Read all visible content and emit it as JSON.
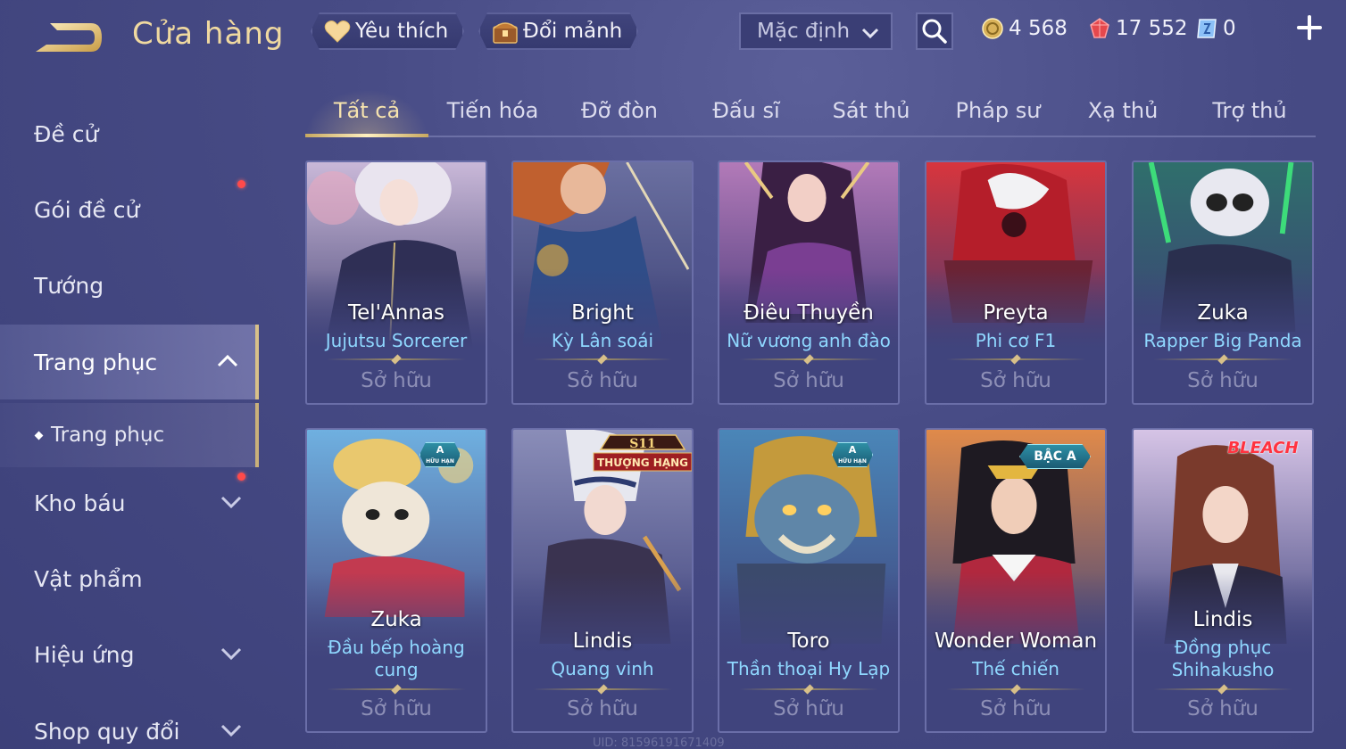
{
  "header": {
    "title": "Cửa hàng",
    "favorites_label": "Yêu thích",
    "exchange_label": "Đổi mảnh",
    "sort": {
      "selected": "Mặc định"
    },
    "currencies": [
      {
        "name": "gold-coin",
        "value": "4 568",
        "color": "#e8c66a"
      },
      {
        "name": "ruby",
        "value": "17 552",
        "color": "#e5484d"
      },
      {
        "name": "voucher",
        "value": "0",
        "color": "#6aa9f0"
      }
    ]
  },
  "sidebar": {
    "items": [
      {
        "label": "Đề cử"
      },
      {
        "label": "Gói đề cử"
      },
      {
        "label": "Tướng"
      },
      {
        "label": "Trang phục"
      },
      {
        "label": "Trang phục"
      },
      {
        "label": "Kho báu"
      },
      {
        "label": "Vật phẩm"
      },
      {
        "label": "Hiệu ứng"
      },
      {
        "label": "Shop quy đổi"
      }
    ]
  },
  "tabs": [
    {
      "label": "Tất cả"
    },
    {
      "label": "Tiến hóa"
    },
    {
      "label": "Đỡ đòn"
    },
    {
      "label": "Đấu sĩ"
    },
    {
      "label": "Sát thủ"
    },
    {
      "label": "Pháp sư"
    },
    {
      "label": "Xạ thủ"
    },
    {
      "label": "Trợ thủ"
    }
  ],
  "cards": [
    {
      "hero": "Tel'Annas",
      "skin": "Jujutsu Sorcerer",
      "status": "Sở hữu"
    },
    {
      "hero": "Bright",
      "skin": "Kỳ Lân soái",
      "status": "Sở hữu"
    },
    {
      "hero": "Điêu Thuyền",
      "skin": "Nữ vương anh đào",
      "status": "Sở hữu"
    },
    {
      "hero": "Preyta",
      "skin": "Phi cơ F1",
      "status": "Sở hữu"
    },
    {
      "hero": "Zuka",
      "skin": "Rapper Big Panda",
      "status": "Sở hữu"
    },
    {
      "hero": "Zuka",
      "skin_line1": "Đầu bếp hoàng",
      "skin_line2": "cung",
      "status": "Sở hữu",
      "badge_top": "A",
      "badge_bottom": "HỮU HẠN"
    },
    {
      "hero": "Lindis",
      "skin": "Quang vinh",
      "status": "Sở hữu",
      "badge_top": "S11",
      "badge_bottom": "THƯỢNG HẠNG"
    },
    {
      "hero": "Toro",
      "skin": "Thần thoại Hy Lạp",
      "status": "Sở hữu",
      "badge_top": "A",
      "badge_bottom": "HỮU HẠN"
    },
    {
      "hero": "Wonder Woman",
      "skin": "Thế chiến",
      "status": "Sở hữu",
      "badge": "BẬC A"
    },
    {
      "hero": "Lindis",
      "skin_line1": "Đồng phục",
      "skin_line2": "Shihakusho",
      "status": "Sở hữu",
      "badge": "BLEACH"
    }
  ],
  "footer": {
    "uid": "UID: 81596191671409"
  }
}
